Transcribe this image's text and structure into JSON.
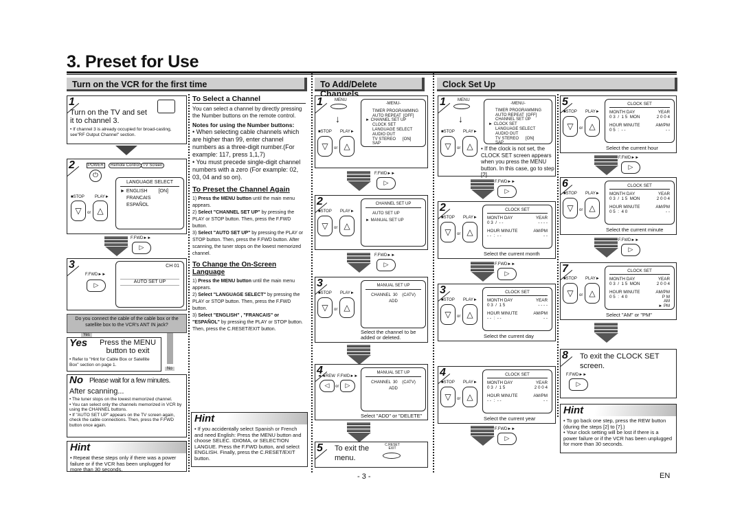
{
  "page_title": "3. Preset for Use",
  "page_number": "- 3 -",
  "language_code": "EN",
  "sections": {
    "vcr": {
      "header": "Turn on the VCR for the first time",
      "step1": {
        "num": "1",
        "text": "Turn on the TV and set it to channel 3.",
        "note": "• If channel 3 is already occupied for broad-casting, see\"RF Output Channel\" section."
      },
      "step2": {
        "num": "2",
        "labels": [
          "POWER",
          "Remote Control",
          "TV Screen"
        ],
        "screen_title": "LANGUAGE SELECT",
        "options": [
          "ENGLISH",
          "FRANCAIS",
          "ESPAÑOL"
        ],
        "selected_state": "[ON]",
        "stop": "■STOP",
        "play": "PLAY►",
        "or": "or",
        "ffwd": "F.FWD►►"
      },
      "step3": {
        "num": "3",
        "ffwd": "F.FWD►►",
        "channel": "CH 01",
        "screen_text": "AUTO SET UP"
      },
      "question": "Do you connect the cable of the cable box or the satellite box to the VCR's ANT IN jack?",
      "yes_label": "Yes",
      "no_label": "No",
      "yes": {
        "title": "Yes",
        "text": "Press the MENU button to exit",
        "note": "• Refer to \"Hint for Cable Box or Satellite Box\" section on page 1."
      },
      "no": {
        "title": "No",
        "text": "Please wait for a few minutes.",
        "after": "After scanning...",
        "bullets": [
          "• The tuner stops on the lowest memorized channel.",
          "• You can select only the channels memorized in VCR by using the CHANNEL buttons.",
          "• If \"AUTO SET UP\" appears on the TV screen again, check the cable connections. Then, press the F.FWD button once again."
        ]
      },
      "hint": {
        "title": "Hint",
        "text": "• Repeat these steps only if there was a power failure or if the VCR has been unplugged for more than 30 seconds."
      }
    },
    "channel_notes": {
      "select_title": "To Select a Channel",
      "select_text": "You can select a channel by directly pressing the Number buttons on the remote control.",
      "notes_title": "Notes for using the Number buttons:",
      "notes": [
        "• When selecting cable channels which are higher than 99, enter channel numbers as a three-digit number.(For example: 117, press 1,1,7)",
        "• You must precede single-digit channel numbers with a zero (For example: 02, 03, 04 and so on)."
      ],
      "preset_title": "To Preset the Channel Again",
      "preset_steps": [
        {
          "bold": "Press the MENU button",
          "rest": " until the main menu appears.",
          "n": "1)"
        },
        {
          "bold": "Select \"CHANNEL SET UP\"",
          "rest": " by pressing the PLAY or STOP button. Then, press the F.FWD button.",
          "n": "2)"
        },
        {
          "bold": "Select \"AUTO SET UP\"",
          "rest": " by pressing the PLAY or STOP button. Then, press the F.FWD button. After scanning, the tuner stops on the lowest memorized channel.",
          "n": "3)"
        }
      ],
      "language_title": "To Change the On-Screen Language",
      "language_steps": [
        {
          "bold": "Press the MENU button",
          "rest": " until the main menu appears.",
          "n": "1)"
        },
        {
          "bold": "Select \"LANGUAGE SELECT\"",
          "rest": " by pressing the PLAY or STOP button. Then, press the F.FWD button.",
          "n": "2)"
        },
        {
          "bold": "Select \"ENGLISH\" , \"FRANCAIS\" or \"ESPAÑOL\"",
          "rest": " by pressing the PLAY or STOP button. Then, press the C.RESET/EXIT button.",
          "n": "3)"
        }
      ],
      "hint": {
        "title": "Hint",
        "text": "• If you accidentally select Spanish or French and need English: Press the MENU button and choose SELEC. IDIOMA, or SELECTION LANGUE. Press the F.FWD button, and select ENGLISH. Finally, press the C.RESET/EXIT button."
      }
    },
    "add_delete": {
      "header": "To Add/Delete Channels",
      "menu_label": "MENU",
      "menu_title": "-MENU-",
      "menu_items": [
        "TIMER PROGRAMMING",
        "AUTO REPEAT  [OFF]",
        "CHANNEL SET UP",
        "CLOCK SET",
        "LANGUAGE SELECT",
        "AUDIO OUT",
        "TV STEREO      [ON]",
        "SAP"
      ],
      "menu_selected_index": 2,
      "step2_title": "CHANNEL SET UP",
      "step2_items": [
        "AUTO SET UP",
        "MANUAL SET UP"
      ],
      "step3_title": "MANUAL SET UP",
      "channel_line": "CHANNEL  30    (CATV)",
      "add": "ADD",
      "step3_caption": "Select the channel to be added or deleted.",
      "step4_caption": "Select \"ADD\" or \"DELETE\"",
      "rew": "◄◄REW",
      "ffwd": "F.FWD►►",
      "stop": "■STOP",
      "play": "PLAY►",
      "or": "or",
      "step5_text": "To exit the menu.",
      "creset": "C.RESET EXIT",
      "nums": [
        "1",
        "2",
        "3",
        "4",
        "5"
      ]
    },
    "clock": {
      "header": "Clock Set Up",
      "menu_label": "MENU",
      "menu_title": "-MENU-",
      "menu_items": [
        "TIMER PROGRAMMING",
        "AUTO REPEAT  [OFF]",
        "CHANNEL SET UP",
        "CLOCK SET",
        "LANGUAGE SELECT",
        "AUDIO OUT",
        "TV STEREO      [ON]",
        "SAP"
      ],
      "menu_selected_index": 3,
      "step1_note": "• If the clock is not set, the CLOCK SET screen appears when you press the MENU button. In this case, go to step [2].",
      "screen_title": "CLOCK SET",
      "col_labels": [
        "MONTH",
        "DAY",
        "YEAR",
        "HOUR",
        "MINUTE",
        "AM/PM"
      ],
      "steps": [
        {
          "num": "2",
          "date": "0 3  /  - -",
          "year": "- - - -",
          "time": "- -  :  - -",
          "ampm": "- -",
          "caption": "Select the current month"
        },
        {
          "num": "3",
          "date": "0 3  /  1 5",
          "year": "- - - -",
          "time": "- -  :  - -",
          "ampm": "- -",
          "caption": "Select the current day"
        },
        {
          "num": "4",
          "date": "0 3  /  1 5",
          "year": "2 0 0 4",
          "time": "- -  :  - -",
          "ampm": "- -",
          "caption": "Select the current year"
        },
        {
          "num": "5",
          "date": "0 3  /  1 5  MON",
          "year": "2 0 0 4",
          "time": "0 5  :  - -",
          "ampm": "- -",
          "caption": "Select the current hour"
        },
        {
          "num": "6",
          "date": "0 3  /  1 5  MON",
          "year": "2 0 0 4",
          "time": "0 5  :  4 0",
          "ampm": "- -",
          "caption": "Select the current minute"
        },
        {
          "num": "7",
          "date": "0 3  /  1 5  MON",
          "year": "2 0 0 4",
          "time": "0 5  :  4 0",
          "ampm": "P M",
          "caption": "Select \"AM\" or \"PM\""
        }
      ],
      "ampm_options": [
        "AM",
        "PM"
      ],
      "stop": "■STOP",
      "play": "PLAY►",
      "or": "or",
      "ffwd": "F.FWD►►",
      "step8": {
        "num": "8",
        "text": "To exit the CLOCK SET screen."
      },
      "hint": {
        "title": "Hint",
        "bullets": [
          "• To go back one step, press the REW button (during the steps [2] to [7].)",
          "• Your clock setting will be lost if there is a power failure or if the VCR has been unplugged for more than 30 seconds."
        ]
      }
    }
  }
}
